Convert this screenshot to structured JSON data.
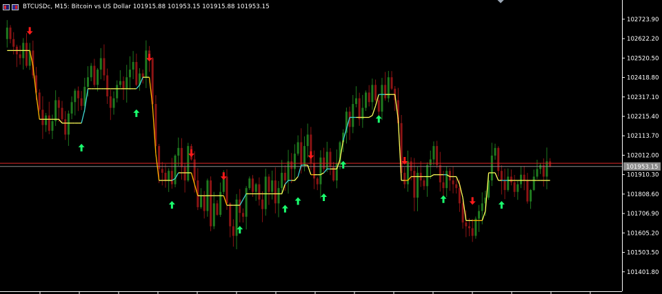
{
  "window": {
    "title": "BTCUSDc, M15:  Bitcoin vs US Dollar  101915.88 101953.15 101915.88 101953.15"
  },
  "colors": {
    "background": "#000000",
    "bull_candle": "#1f7a1f",
    "bear_candle": "#8c1414",
    "buy_arrow": "#1aff6e",
    "sell_arrow": "#ff1a1a",
    "trend_up_line": "#3fd6d6",
    "trend_down_line": "#ffb400",
    "flat_line": "#ffff5a",
    "bid_line": "#8c8c8c",
    "level_line": "#e02828",
    "price_label_bg": "#8c8c8c",
    "axis_text": "#ffffff",
    "axis_line": "#ffffff"
  },
  "chart_data": {
    "type": "candlestick",
    "symbol": "BTCUSDc",
    "timeframe": "M15",
    "ylim": [
      101300,
      102810
    ],
    "y_ticks": [
      "102723.90",
      "102622.20",
      "102520.50",
      "102418.80",
      "102317.10",
      "102215.40",
      "102113.70",
      "102012.00",
      "101910.30",
      "101808.60",
      "101706.90",
      "101605.20",
      "101503.50",
      "101401.80"
    ],
    "current_price_label": "101953.15",
    "current_price": 101953.15,
    "level_price": 101970,
    "trend_line": [
      102560,
      102560,
      102560,
      102560,
      102560,
      102560,
      102560,
      102560,
      102480,
      102330,
      102200,
      102200,
      102200,
      102200,
      102200,
      102200,
      102200,
      102180,
      102180,
      102180,
      102180,
      102180,
      102180,
      102180,
      102250,
      102360,
      102360,
      102360,
      102360,
      102360,
      102360,
      102360,
      102360,
      102360,
      102360,
      102360,
      102360,
      102360,
      102360,
      102360,
      102360,
      102380,
      102420,
      102420,
      102420,
      102270,
      102020,
      101880,
      101880,
      101880,
      101880,
      101880,
      101890,
      101920,
      101920,
      101920,
      101920,
      101920,
      101860,
      101800,
      101800,
      101800,
      101800,
      101800,
      101800,
      101800,
      101800,
      101800,
      101750,
      101750,
      101750,
      101750,
      101750,
      101780,
      101810,
      101810,
      101810,
      101810,
      101810,
      101810,
      101810,
      101810,
      101810,
      101810,
      101810,
      101810,
      101860,
      101880,
      101880,
      101880,
      101900,
      101960,
      101960,
      101960,
      101910,
      101910,
      101910,
      101910,
      101920,
      101940,
      101940,
      101940,
      101940,
      101990,
      102090,
      102150,
      102210,
      102210,
      102210,
      102210,
      102210,
      102210,
      102210,
      102220,
      102270,
      102330,
      102330,
      102330,
      102330,
      102330,
      102330,
      102200,
      101880,
      101880,
      101880,
      101900,
      101900,
      101900,
      101900,
      101900,
      101900,
      101900,
      101910,
      101910,
      101910,
      101910,
      101910,
      101900,
      101900,
      101900,
      101860,
      101790,
      101670,
      101670,
      101670,
      101670,
      101670,
      101670,
      101720,
      101920,
      101920,
      101920,
      101880,
      101880,
      101880,
      101880,
      101880,
      101880,
      101880,
      101880,
      101880,
      101880,
      101880,
      101880,
      101880,
      101880,
      101880,
      101880,
      101880,
      101890,
      101900,
      101900,
      101900
    ],
    "trend_color_seq": [
      "flat",
      "flat",
      "flat",
      "flat",
      "flat",
      "flat",
      "flat",
      "flat",
      "down",
      "down",
      "down",
      "flat",
      "flat",
      "flat",
      "flat",
      "flat",
      "flat",
      "flat",
      "flat",
      "flat",
      "flat",
      "flat",
      "flat",
      "flat",
      "up",
      "up",
      "flat",
      "flat",
      "flat",
      "flat",
      "flat",
      "flat",
      "flat",
      "flat",
      "flat",
      "flat",
      "flat",
      "flat",
      "flat",
      "flat",
      "flat",
      "up",
      "up",
      "flat",
      "flat",
      "down",
      "down",
      "down",
      "flat",
      "flat",
      "flat",
      "flat",
      "up",
      "up",
      "flat",
      "flat",
      "flat",
      "flat",
      "down",
      "down",
      "flat",
      "flat",
      "flat",
      "flat",
      "flat",
      "flat",
      "flat",
      "flat",
      "down",
      "flat",
      "flat",
      "flat",
      "flat",
      "up",
      "up",
      "flat",
      "flat",
      "flat",
      "flat",
      "flat",
      "flat",
      "flat",
      "flat",
      "flat",
      "flat",
      "flat",
      "flat",
      "up",
      "up",
      "flat",
      "flat",
      "up",
      "up",
      "flat",
      "flat",
      "down",
      "flat",
      "flat",
      "flat",
      "up",
      "up",
      "flat",
      "flat",
      "flat",
      "flat",
      "up",
      "up",
      "up",
      "up",
      "flat",
      "flat",
      "flat",
      "flat",
      "flat",
      "flat",
      "flat",
      "up",
      "up",
      "flat",
      "flat",
      "flat",
      "flat",
      "flat",
      "flat",
      "down",
      "down",
      "flat",
      "flat",
      "flat",
      "flat",
      "flat",
      "flat",
      "flat",
      "flat",
      "flat",
      "flat",
      "up",
      "flat",
      "flat",
      "flat",
      "flat",
      "flat",
      "flat",
      "flat",
      "flat",
      "down",
      "down",
      "down",
      "flat",
      "flat",
      "flat",
      "flat",
      "flat",
      "flat",
      "up",
      "up",
      "flat",
      "flat",
      "flat",
      "flat",
      "flat",
      "flat",
      "flat",
      "flat",
      "flat",
      "flat",
      "flat",
      "flat",
      "flat",
      "flat",
      "flat",
      "flat",
      "flat",
      "flat",
      "flat",
      "up",
      "up",
      "flat",
      "flat"
    ],
    "candles_close": [
      102680,
      102620,
      102580,
      102540,
      102520,
      102600,
      102480,
      102560,
      102430,
      102340,
      102250,
      102170,
      102220,
      102140,
      102190,
      102300,
      102260,
      102200,
      102120,
      102230,
      102290,
      102350,
      102310,
      102270,
      102370,
      102420,
      102480,
      102380,
      102460,
      102520,
      102430,
      102320,
      102260,
      102310,
      102380,
      102400,
      102360,
      102420,
      102460,
      102500,
      102380,
      102440,
      102420,
      102560,
      102520,
      102280,
      102060,
      101940,
      101920,
      101880,
      101930,
      101860,
      102010,
      102050,
      101950,
      101880,
      102060,
      101990,
      101880,
      101740,
      101800,
      101720,
      101880,
      101640,
      101760,
      101700,
      101820,
      101900,
      101760,
      101640,
      101590,
      101780,
      101710,
      101690,
      101840,
      101890,
      101820,
      101860,
      101780,
      101730,
      101900,
      101820,
      101880,
      101760,
      101840,
      101920,
      101880,
      101980,
      101940,
      102020,
      102080,
      101960,
      102060,
      102120,
      101970,
      101890,
      101860,
      102000,
      101940,
      102030,
      101950,
      101880,
      101970,
      102080,
      102130,
      102240,
      102160,
      102280,
      102310,
      102200,
      102260,
      102340,
      102290,
      102380,
      102300,
      102240,
      102380,
      102310,
      102420,
      102360,
      102300,
      102180,
      101920,
      101860,
      101980,
      101930,
      101790,
      101920,
      101880,
      101850,
      101960,
      101990,
      102060,
      101960,
      101870,
      101840,
      101930,
      101880,
      101860,
      101840,
      101760,
      101660,
      101640,
      101630,
      101590,
      101680,
      101720,
      101760,
      101790,
      101880,
      102010,
      102050,
      101930,
      101880,
      101830,
      101900,
      101870,
      101820,
      101860,
      101910,
      101880,
      101770,
      101830,
      101900,
      101940,
      101960,
      101900,
      101980,
      101953
    ]
  },
  "signals": {
    "buy_label": "buy-arrow",
    "sell_label": "sell-arrow"
  }
}
